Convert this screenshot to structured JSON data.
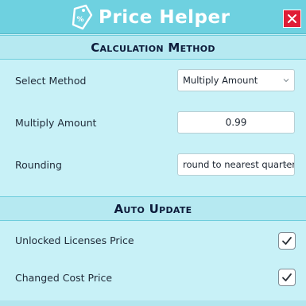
{
  "app": {
    "title": "Price Helper",
    "close_label": "✕"
  },
  "sections": {
    "calculation": {
      "title": "Calculation Method",
      "select_method": {
        "label": "Select Method",
        "value": "Multiply Amount"
      },
      "multiply_amount": {
        "label": "Multiply Amount",
        "value": "0.99"
      },
      "rounding": {
        "label": "Rounding",
        "value": "round to nearest quarter"
      }
    },
    "auto_update": {
      "title": "Auto Update",
      "unlocked_licenses": {
        "label": "Unlocked Licenses Price",
        "checked": true
      },
      "changed_cost": {
        "label": "Changed Cost Price",
        "checked": true
      }
    }
  },
  "colors": {
    "titlebar": "#6ed1e0",
    "background": "#c8f1f7",
    "section_header": "#b6e9f1",
    "close_button": "#e01e36"
  },
  "icons": {
    "logo": "price-tag-icon",
    "close": "close-icon",
    "dropdown": "chevron-down-icon",
    "check": "checkmark-icon"
  }
}
